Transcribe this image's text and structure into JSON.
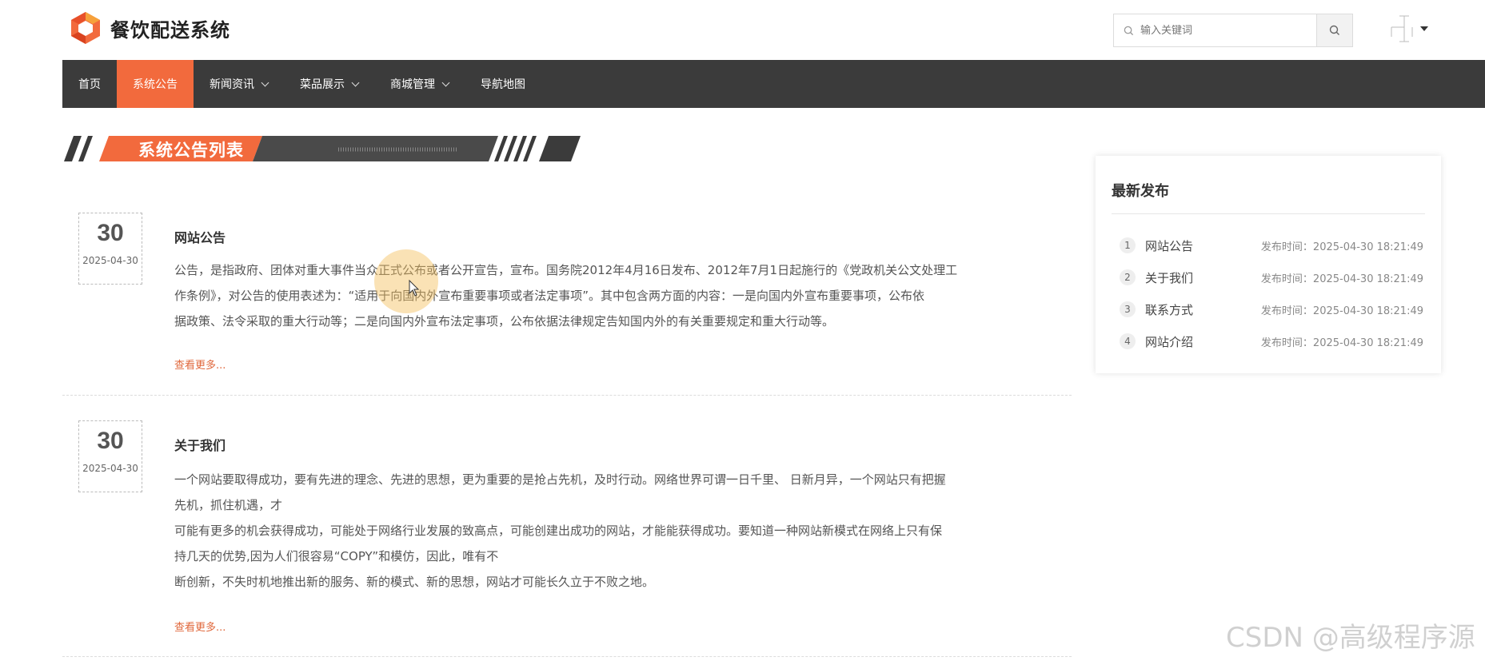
{
  "header": {
    "title": "餐饮配送系统",
    "search": {
      "placeholder": "输入关键词"
    }
  },
  "nav": {
    "items": [
      {
        "label": "首页",
        "active": false,
        "dropdown": false
      },
      {
        "label": "系统公告",
        "active": true,
        "dropdown": false
      },
      {
        "label": "新闻资讯",
        "active": false,
        "dropdown": true
      },
      {
        "label": "菜品展示",
        "active": false,
        "dropdown": true
      },
      {
        "label": "商城管理",
        "active": false,
        "dropdown": true
      },
      {
        "label": "导航地图",
        "active": false,
        "dropdown": false
      }
    ]
  },
  "section": {
    "title": "系统公告列表"
  },
  "articles": [
    {
      "day": "30",
      "date": "2025-04-30",
      "title": "网站公告",
      "lines": [
        "公告，是指政府、团体对重大事件当众正式公布或者公开宣告，宣布。国务院2012年4月16日发布、2012年7月1日起施行的《党政机关公文处理工",
        "作条例》，对公告的使用表述为：“适用于向国内外宣布重要事项或者法定事项”。其中包含两方面的内容：一是向国内外宣布重要事项，公布依",
        "据政策、法令采取的重大行动等；二是向国内外宣布法定事项，公布依据法律规定告知国内外的有关重要规定和重大行动等。"
      ],
      "more": "查看更多..."
    },
    {
      "day": "30",
      "date": "2025-04-30",
      "title": "关于我们",
      "lines": [
        "一个网站要取得成功，要有先进的理念、先进的思想，更为重要的是抢占先机，及时行动。网络世界可谓一日千里、 日新月异，一个网站只有把握",
        "先机，抓住机遇，才",
        "可能有更多的机会获得成功，可能处于网络行业发展的致高点，可能创建出成功的网站，才能能获得成功。要知道一种网站新模式在网络上只有保",
        "持几天的优势,因为人们很容易“COPY”和模仿，因此，唯有不",
        "断创新，不失时机地推出新的服务、新的模式、新的思想，网站才可能长久立于不败之地。"
      ],
      "more": "查看更多..."
    }
  ],
  "sidebar": {
    "title": "最新发布",
    "items": [
      {
        "num": "1",
        "label": "网站公告",
        "time": "发布时间：2025-04-30 18:21:49"
      },
      {
        "num": "2",
        "label": "关于我们",
        "time": "发布时间：2025-04-30 18:21:49"
      },
      {
        "num": "3",
        "label": "联系方式",
        "time": "发布时间：2025-04-30 18:21:49"
      },
      {
        "num": "4",
        "label": "网站介绍",
        "time": "发布时间：2025-04-30 18:21:49"
      }
    ]
  },
  "watermark": "CSDN @高级程序源",
  "colors": {
    "accent": "#f26a3d",
    "nav_bg": "#3b3b3b",
    "link": "#e0683c"
  },
  "icons": [
    "logo-icon",
    "search-icon",
    "search-button-icon",
    "avatar-icon",
    "chevron-down-icon"
  ]
}
